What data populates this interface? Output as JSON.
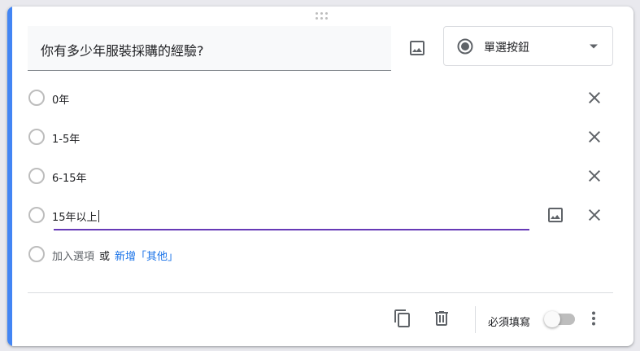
{
  "question": {
    "title": "你有多少年服裝採購的經驗?"
  },
  "question_type": {
    "selected": "單選按鈕",
    "icon": "radio-button-checked-icon"
  },
  "options": [
    {
      "label": "0年"
    },
    {
      "label": "1-5年"
    },
    {
      "label": "6-15年"
    },
    {
      "label": "15年以上"
    }
  ],
  "add_row": {
    "add_option": "加入選項",
    "or": "或",
    "add_other": "新增「其他」"
  },
  "footer": {
    "required_label": "必須填寫",
    "required_on": false
  },
  "colors": {
    "accent": "#4285f4",
    "active_underline": "#673ab7",
    "link": "#1a73e8"
  }
}
